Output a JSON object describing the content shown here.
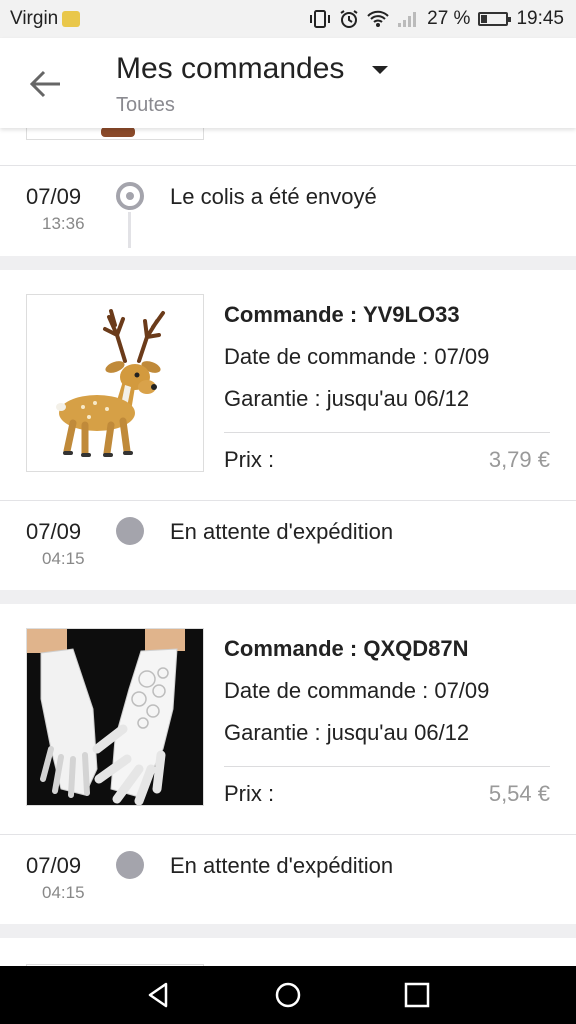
{
  "status_bar": {
    "carrier": "Virgin",
    "battery_percent": "27 %",
    "battery_level": 0.27,
    "time": "19:45",
    "icons": [
      "vibrate-icon",
      "alarm-icon",
      "wifi-icon",
      "signal-icon",
      "battery-icon"
    ]
  },
  "header": {
    "title": "Mes commandes",
    "filter": "Toutes",
    "back_icon": "arrow-left-icon",
    "dropdown_icon": "caret-down-icon"
  },
  "top_status": {
    "date": "07/09",
    "time": "13:36",
    "text": "Le colis a été envoyé"
  },
  "orders": [
    {
      "order_label": "Commande : YV9LO33",
      "date_line": "Date de commande : 07/09",
      "warranty_line": "Garantie : jusqu'au 06/12",
      "price_label": "Prix :",
      "price_value": "3,79 €",
      "status_date": "07/09",
      "status_time": "04:15",
      "status_text": "En attente d'expédition",
      "image": "deer-figurine"
    },
    {
      "order_label": "Commande : QXQD87N",
      "date_line": "Date de commande : 07/09",
      "warranty_line": "Garantie : jusqu'au 06/12",
      "price_label": "Prix :",
      "price_value": "5,54 €",
      "status_date": "07/09",
      "status_time": "04:15",
      "status_text": "En attente d'expédition",
      "image": "white-lace-gloves"
    }
  ],
  "nav_bar": {
    "back": "nav-back-icon",
    "home": "nav-home-icon",
    "recents": "nav-recents-icon"
  }
}
